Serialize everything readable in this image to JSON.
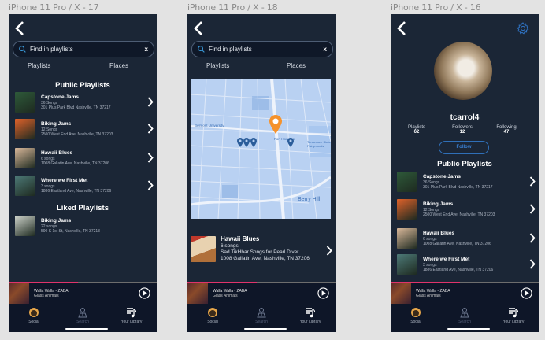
{
  "frames": [
    {
      "label": "iPhone 11 Pro / X - 17"
    },
    {
      "label": "iPhone 11 Pro / X - 18"
    },
    {
      "label": "iPhone 11 Pro / X - 16"
    }
  ],
  "search": {
    "placeholder": "Find in playlists",
    "clear_label": "x"
  },
  "tabs": {
    "playlists": "Playlists",
    "places": "Places"
  },
  "sections": {
    "public": "Public Playlists",
    "liked": "Liked Playlists"
  },
  "public_playlists": [
    {
      "title": "Capstone Jams",
      "songs": "36 Songs",
      "address": "301 Plus Park Blvd Nashville, TN 37217",
      "art": "#2e5a3a"
    },
    {
      "title": "Biking Jams",
      "songs": "12 Songs",
      "address": "2500 West End Ave, Nashville, TN 37203",
      "art": "#e0622a"
    },
    {
      "title": "Hawaii Blues",
      "songs": "6 songs",
      "address": "1008 Gallatin Ave, Nashville, TN 37206",
      "art": "#d9b89a"
    },
    {
      "title": "Where we First Met",
      "songs": "3 songs",
      "address": "1886 Eastland Ave, Nashville, TN 37206",
      "art": "#4d7a78"
    }
  ],
  "liked_playlists": [
    {
      "title": "Biking Jams",
      "songs": "22 songs",
      "address": "590 S 1st St, Nashville, TN 37213",
      "art": "#cfd4cc"
    }
  ],
  "map": {
    "labels": {
      "belmont": "Belmont University",
      "fort_houston": "Fort Houston",
      "fairgrounds": "Tennessee State Fairgrounds",
      "berry_hill": "Berry Hill"
    },
    "selected_pin_color": "#f5922b",
    "pin_color": "#2b5d9a"
  },
  "place_card": {
    "title": "Hawaii Blues",
    "songs": "6 songs",
    "description": "Sad TikHbar Songs for Pearl Diver",
    "address": "1008 Gallatin Ave, Nashville, TN 37206"
  },
  "player": {
    "song": "Walla Walla - ZABA",
    "artist": "Glass Animals",
    "progress": 0.47
  },
  "nav": {
    "social": "Social",
    "search": "Search",
    "library": "Your Library"
  },
  "profile": {
    "username": "tcarrol4",
    "stats": [
      {
        "label": "Playlists",
        "value": "62"
      },
      {
        "label": "Followers",
        "value": "12"
      },
      {
        "label": "Following",
        "value": "47"
      }
    ],
    "follow_label": "Follow"
  },
  "colors": {
    "accent": "#3b82d6",
    "progress": "#e0336b",
    "background": "#1b2636"
  }
}
